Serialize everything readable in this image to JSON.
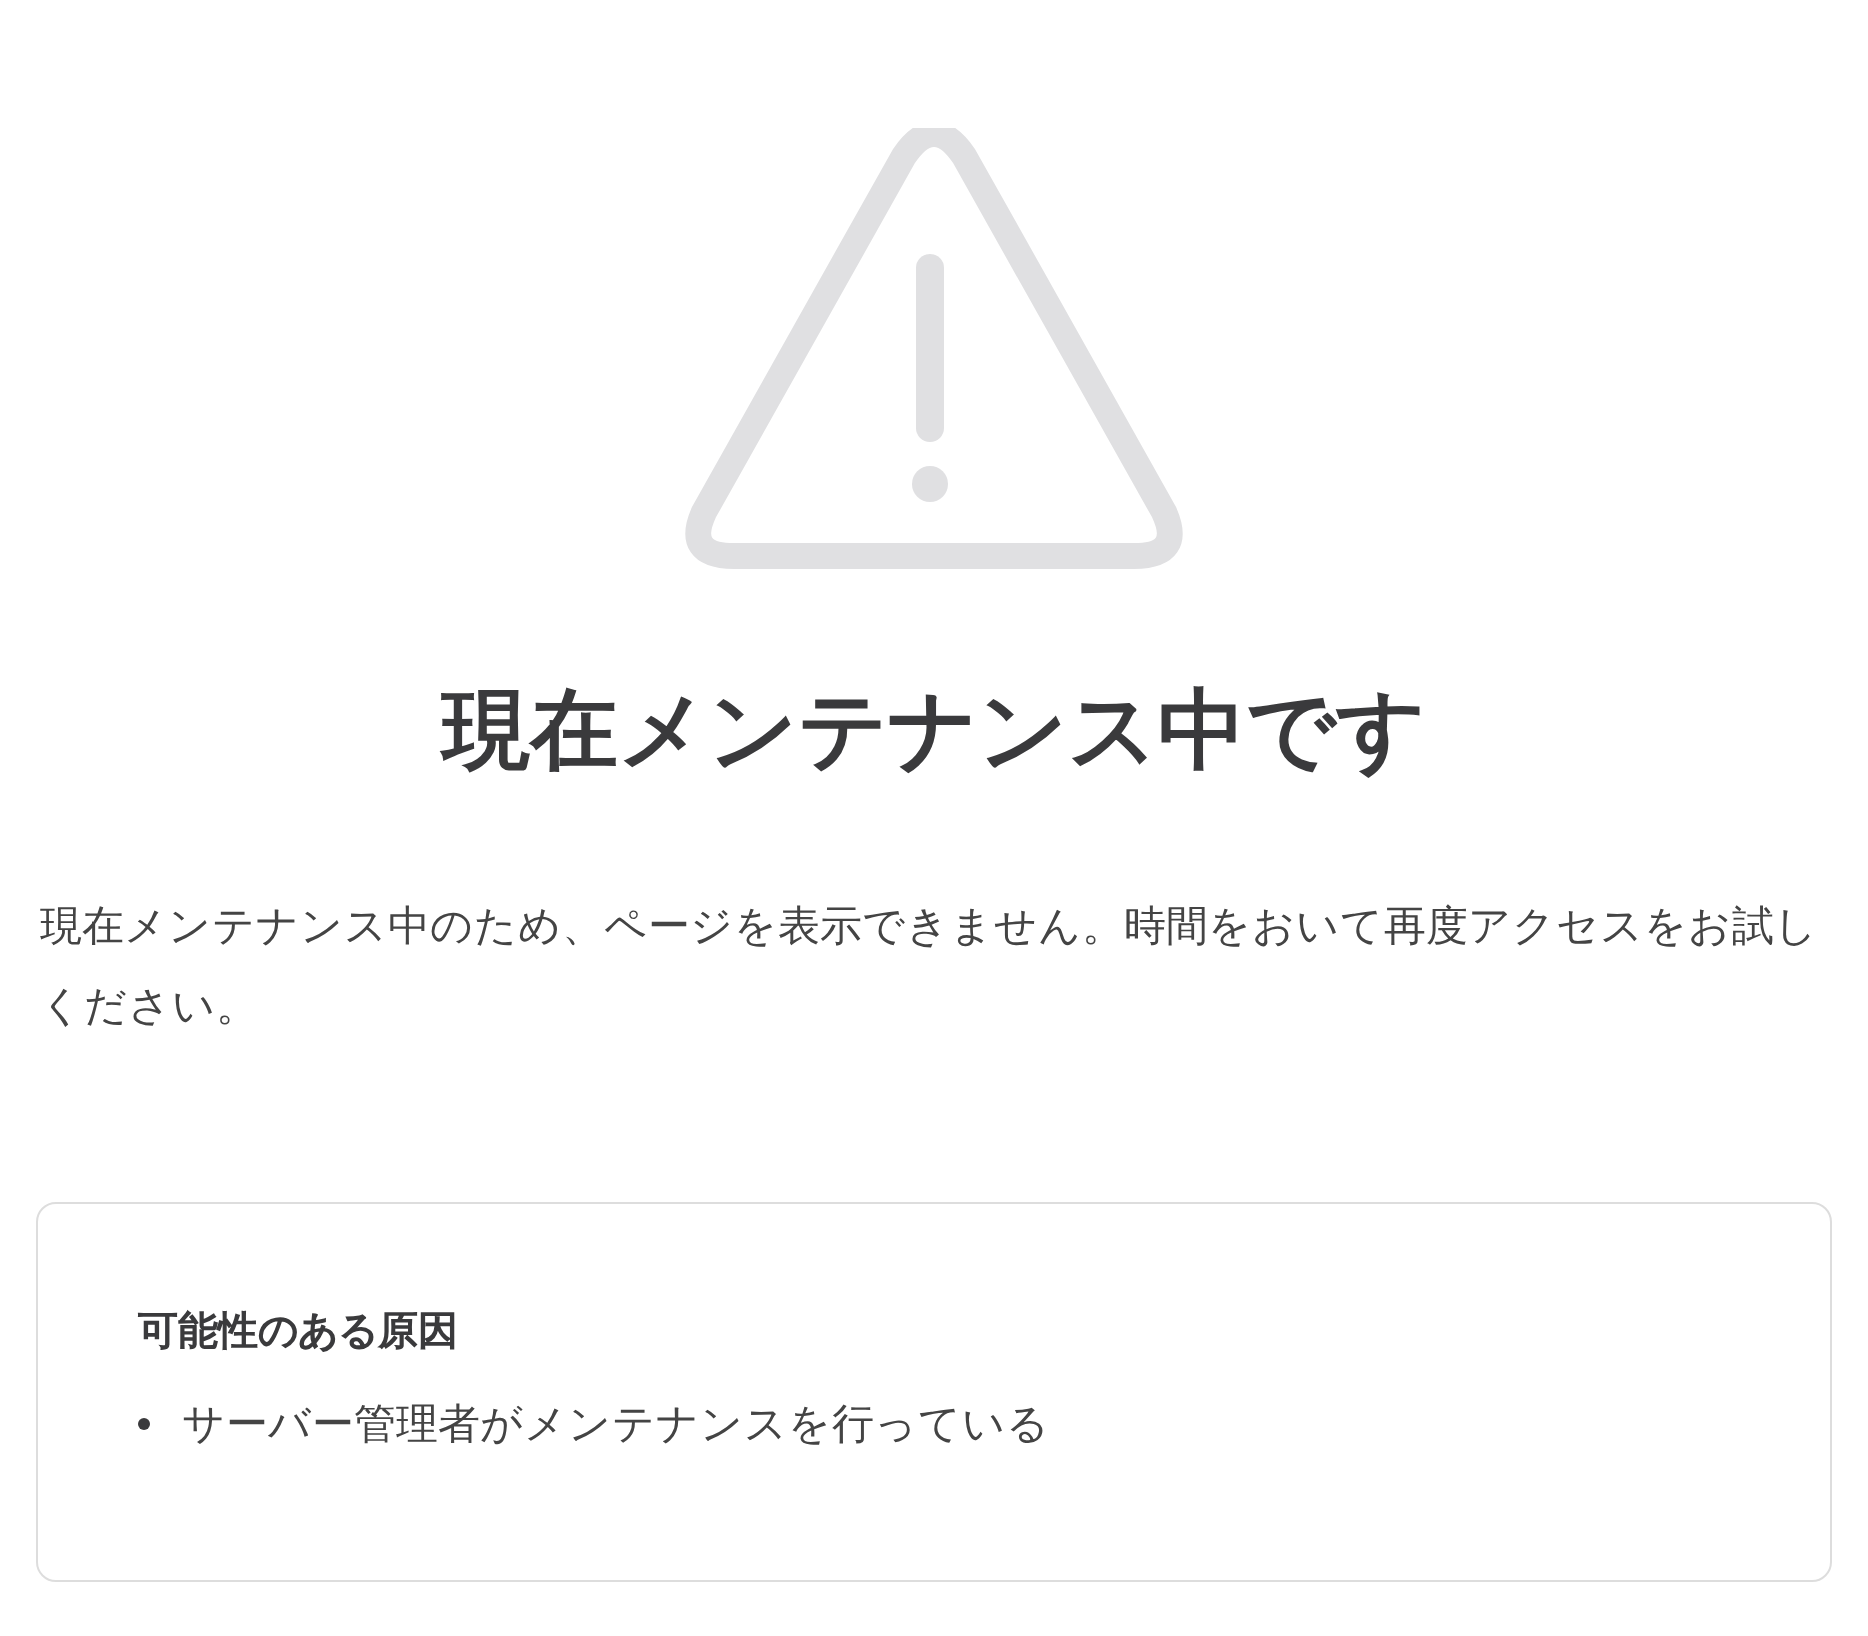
{
  "heading": "現在メンテナンス中です",
  "message": "現在メンテナンス中のため、ページを表示できません。時間をおいて再度アクセスをお試しください。",
  "causes": {
    "title": "可能性のある原因",
    "items": [
      "サーバー管理者がメンテナンスを行っている"
    ]
  }
}
